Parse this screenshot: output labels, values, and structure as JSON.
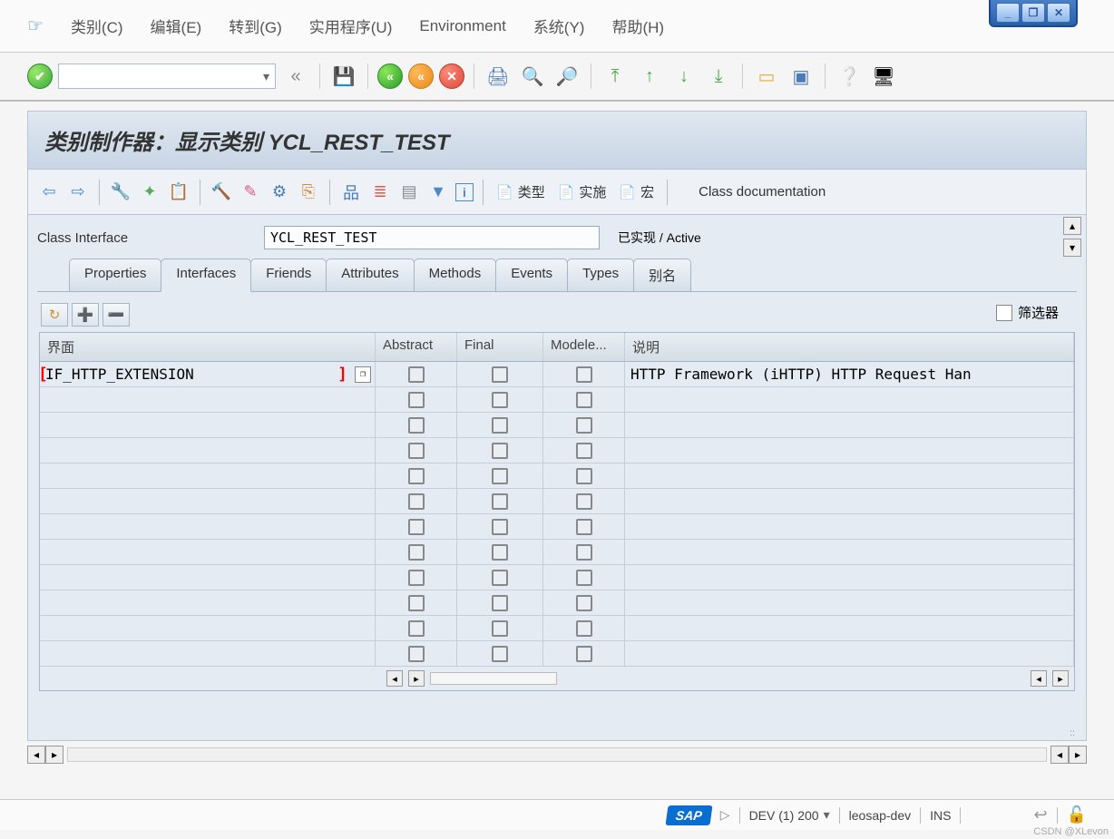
{
  "window_controls": {
    "minimize": "_",
    "maximize": "❐",
    "close": "✕"
  },
  "menubar": {
    "items": [
      {
        "label": "类别(C)",
        "accel": "C"
      },
      {
        "label": "编辑(E)",
        "accel": "E"
      },
      {
        "label": "转到(G)",
        "accel": "G"
      },
      {
        "label": "实用程序(U)",
        "accel": "U"
      },
      {
        "label": "Environment",
        "accel": ""
      },
      {
        "label": "系统(Y)",
        "accel": "Y"
      },
      {
        "label": "帮助(H)",
        "accel": "H"
      }
    ]
  },
  "toolbar": {
    "combo_value": "",
    "icons": [
      "back-icon",
      "save-icon",
      "back-green-icon",
      "exit-orange-icon",
      "cancel-red-icon",
      "print-icon",
      "find-icon",
      "find-next-icon",
      "first-page-icon",
      "prev-page-icon",
      "next-page-icon",
      "last-page-icon",
      "new-session-icon",
      "generate-icon",
      "help-icon",
      "layout-icon"
    ]
  },
  "title": "类别制作器：显示类别 YCL_REST_TEST",
  "toolbar2": {
    "nav": {
      "back": "⇦",
      "forward": "⇨"
    },
    "buttons": [
      "display-change-icon",
      "other-object-icon",
      "check-icon",
      "activate-icon",
      "where-used-icon",
      "test-icon",
      "display-object-list-icon",
      "hierarchy-icon",
      "sort-icon",
      "local-types-icon",
      "filter-icon",
      "info-icon"
    ],
    "text_buttons": [
      {
        "label": "类型"
      },
      {
        "label": "实施"
      },
      {
        "label": "宏"
      }
    ],
    "doc_label": "Class documentation"
  },
  "class_interface": {
    "label": "Class Interface",
    "value": "YCL_REST_TEST",
    "status": "已实现 / Active"
  },
  "tabs": [
    {
      "label": "Properties",
      "active": false
    },
    {
      "label": "Interfaces",
      "active": true
    },
    {
      "label": "Friends",
      "active": false
    },
    {
      "label": "Attributes",
      "active": false
    },
    {
      "label": "Methods",
      "active": false
    },
    {
      "label": "Events",
      "active": false
    },
    {
      "label": "Types",
      "active": false
    },
    {
      "label": "别名",
      "active": false
    }
  ],
  "filter_label": "筛选器",
  "grid": {
    "columns": {
      "interface": "界面",
      "abstract": "Abstract",
      "final": "Final",
      "modele": "Modele...",
      "desc": "说明"
    },
    "rows": [
      {
        "interface": "IF_HTTP_EXTENSION",
        "abstract": false,
        "final": false,
        "modele": false,
        "desc": "HTTP Framework (iHTTP) HTTP Request Han"
      },
      {
        "interface": "",
        "abstract": false,
        "final": false,
        "modele": false,
        "desc": ""
      },
      {
        "interface": "",
        "abstract": false,
        "final": false,
        "modele": false,
        "desc": ""
      },
      {
        "interface": "",
        "abstract": false,
        "final": false,
        "modele": false,
        "desc": ""
      },
      {
        "interface": "",
        "abstract": false,
        "final": false,
        "modele": false,
        "desc": ""
      },
      {
        "interface": "",
        "abstract": false,
        "final": false,
        "modele": false,
        "desc": ""
      },
      {
        "interface": "",
        "abstract": false,
        "final": false,
        "modele": false,
        "desc": ""
      },
      {
        "interface": "",
        "abstract": false,
        "final": false,
        "modele": false,
        "desc": ""
      },
      {
        "interface": "",
        "abstract": false,
        "final": false,
        "modele": false,
        "desc": ""
      },
      {
        "interface": "",
        "abstract": false,
        "final": false,
        "modele": false,
        "desc": ""
      },
      {
        "interface": "",
        "abstract": false,
        "final": false,
        "modele": false,
        "desc": ""
      },
      {
        "interface": "",
        "abstract": false,
        "final": false,
        "modele": false,
        "desc": ""
      }
    ]
  },
  "statusbar": {
    "sap": "SAP",
    "system": "DEV (1) 200",
    "server": "leosap-dev",
    "mode": "INS"
  },
  "watermark": "CSDN @XLevon"
}
